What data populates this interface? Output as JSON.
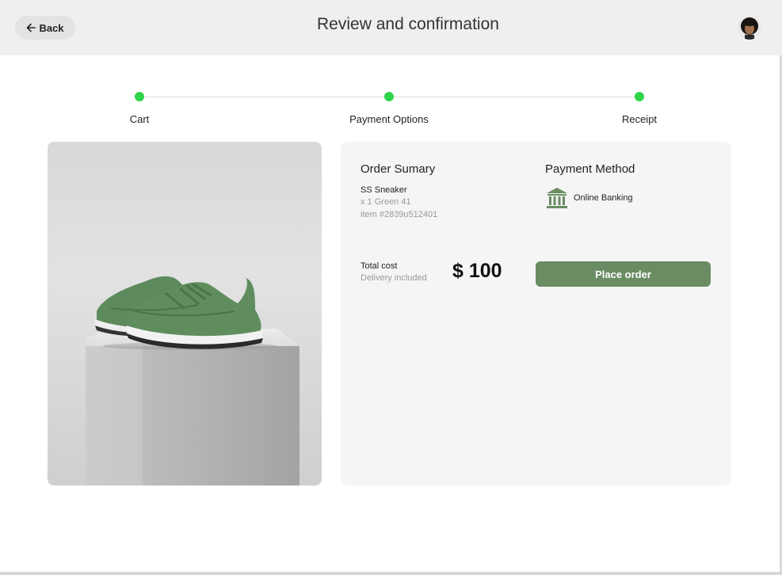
{
  "header": {
    "back_label": "Back",
    "title": "Review and confirmation"
  },
  "stepper": {
    "steps": [
      {
        "label": "Cart",
        "status": "complete"
      },
      {
        "label": "Payment Options",
        "status": "complete"
      },
      {
        "label": "Receipt",
        "status": "complete"
      }
    ]
  },
  "order_summary": {
    "title": "Order Sumary",
    "item_name": "SS Sneaker",
    "item_variant": "x 1 Green 41",
    "item_id": "item #2839u512401"
  },
  "payment_method": {
    "title": "Payment Method",
    "method": "Online Banking",
    "icon": "bank-icon"
  },
  "total": {
    "label": "Total cost",
    "sublabel": "Delivery included",
    "amount": "$ 100"
  },
  "actions": {
    "place_order_label": "Place order"
  },
  "colors": {
    "accent": "#6a8c63",
    "step_complete": "#2fd34a",
    "header_bg": "#efefef",
    "card_bg": "#f5f5f5"
  }
}
